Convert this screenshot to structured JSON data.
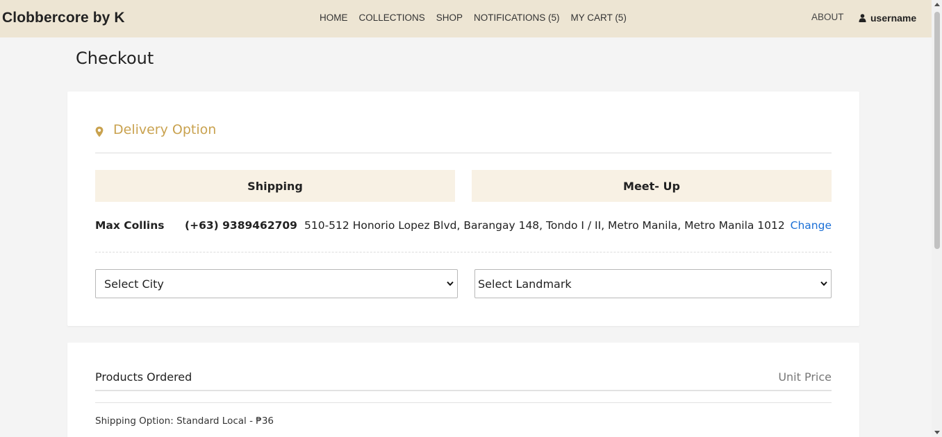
{
  "header": {
    "brand": "Clobbercore by K",
    "nav": [
      "HOME",
      "COLLECTIONS",
      "SHOP",
      "NOTIFICATIONS (5)",
      "MY CART (5)"
    ],
    "about": "ABOUT",
    "username": "username",
    "bg_color": "#ede5d3"
  },
  "page": {
    "title": "Checkout"
  },
  "delivery": {
    "title": "Delivery Option",
    "accent_color": "#c9a24f",
    "icon": "map-pin-icon",
    "options": {
      "shipping": "Shipping",
      "meetup": "Meet- Up"
    },
    "option_bg": "#f8f1e4",
    "address": {
      "name": "Max Collins",
      "phone": "(+63) 9389462709",
      "text": "510-512 Honorio Lopez Blvd, Barangay 148, Tondo I / II, Metro Manila, Metro Manila 1012",
      "change": "Change",
      "link_color": "#1a6fd6"
    },
    "city_select": {
      "selected": "Select City"
    },
    "landmark_select": {
      "selected": "Select Landmark"
    }
  },
  "products": {
    "title": "Products Ordered",
    "unit_price": "Unit Price",
    "shipping_option": "Shipping Option: Standard Local - ₱36"
  }
}
